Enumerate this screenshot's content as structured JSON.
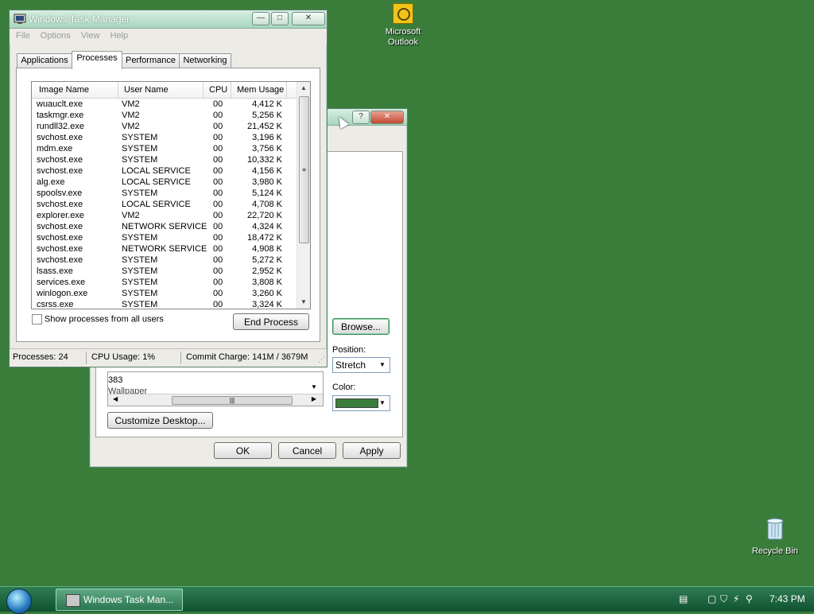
{
  "desktop": {
    "icons": [
      {
        "label_line1": "Microsoft",
        "label_line2": "Outlook",
        "icon": "outlook-icon"
      },
      {
        "label": "Recycle Bin",
        "icon": "recycle-bin-icon"
      }
    ]
  },
  "task_manager": {
    "title": "Windows Task Manager",
    "menu": [
      "File",
      "Options",
      "View",
      "Help"
    ],
    "tabs": [
      "Applications",
      "Processes",
      "Performance",
      "Networking"
    ],
    "active_tab": "Processes",
    "columns": [
      "Image Name",
      "User Name",
      "CPU",
      "Mem Usage"
    ],
    "processes": [
      {
        "name": "wuauclt.exe",
        "user": "VM2",
        "cpu": "00",
        "mem": "4,412 K"
      },
      {
        "name": "taskmgr.exe",
        "user": "VM2",
        "cpu": "00",
        "mem": "5,256 K"
      },
      {
        "name": "rundll32.exe",
        "user": "VM2",
        "cpu": "00",
        "mem": "21,452 K"
      },
      {
        "name": "svchost.exe",
        "user": "SYSTEM",
        "cpu": "00",
        "mem": "3,196 K"
      },
      {
        "name": "mdm.exe",
        "user": "SYSTEM",
        "cpu": "00",
        "mem": "3,756 K"
      },
      {
        "name": "svchost.exe",
        "user": "SYSTEM",
        "cpu": "00",
        "mem": "10,332 K"
      },
      {
        "name": "svchost.exe",
        "user": "LOCAL SERVICE",
        "cpu": "00",
        "mem": "4,156 K"
      },
      {
        "name": "alg.exe",
        "user": "LOCAL SERVICE",
        "cpu": "00",
        "mem": "3,980 K"
      },
      {
        "name": "spoolsv.exe",
        "user": "SYSTEM",
        "cpu": "00",
        "mem": "5,124 K"
      },
      {
        "name": "svchost.exe",
        "user": "LOCAL SERVICE",
        "cpu": "00",
        "mem": "4,708 K"
      },
      {
        "name": "explorer.exe",
        "user": "VM2",
        "cpu": "00",
        "mem": "22,720 K"
      },
      {
        "name": "svchost.exe",
        "user": "NETWORK SERVICE",
        "cpu": "00",
        "mem": "4,324 K"
      },
      {
        "name": "svchost.exe",
        "user": "SYSTEM",
        "cpu": "00",
        "mem": "18,472 K"
      },
      {
        "name": "svchost.exe",
        "user": "NETWORK SERVICE",
        "cpu": "00",
        "mem": "4,908 K"
      },
      {
        "name": "svchost.exe",
        "user": "SYSTEM",
        "cpu": "00",
        "mem": "5,272 K"
      },
      {
        "name": "lsass.exe",
        "user": "SYSTEM",
        "cpu": "00",
        "mem": "2,952 K"
      },
      {
        "name": "services.exe",
        "user": "SYSTEM",
        "cpu": "00",
        "mem": "3,808 K"
      },
      {
        "name": "winlogon.exe",
        "user": "SYSTEM",
        "cpu": "00",
        "mem": "3,260 K"
      },
      {
        "name": "csrss.exe",
        "user": "SYSTEM",
        "cpu": "00",
        "mem": "3,324 K"
      }
    ],
    "show_all_label": "Show processes from all users",
    "end_process_label": "End Process",
    "status": {
      "processes": "Processes: 24",
      "cpu": "CPU Usage: 1%",
      "commit": "Commit Charge: 141M / 3679M"
    }
  },
  "display_dialog": {
    "help_glyph": "?",
    "close_glyph": "✕",
    "browse_label": "Browse...",
    "position_label": "Position:",
    "position_value": "Stretch",
    "color_label": "Color:",
    "color_value": "#3a7d3b",
    "list_fragment_1": "383",
    "list_fragment_2": "Wallpaper",
    "customize_label": "Customize Desktop...",
    "ok_label": "OK",
    "cancel_label": "Cancel",
    "apply_label": "Apply"
  },
  "taskbar": {
    "task_label": "Windows Task Man...",
    "clock": "7:43 PM"
  }
}
